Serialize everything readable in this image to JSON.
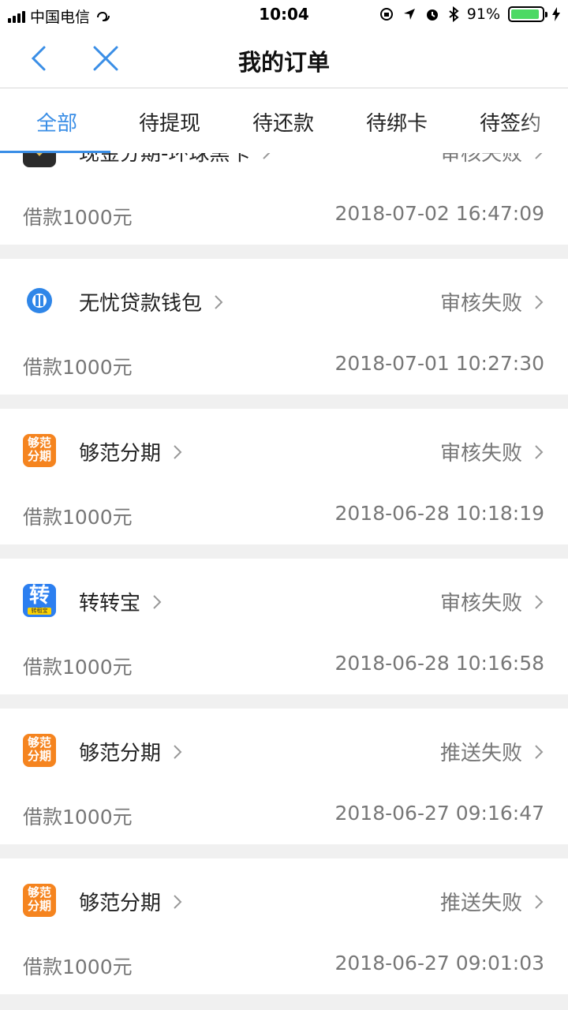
{
  "status_bar": {
    "carrier": "中国电信",
    "time": "10:04",
    "battery": "91%",
    "battery_level": 0.91
  },
  "nav": {
    "title": "我的订单"
  },
  "tabs": [
    {
      "label": "全部",
      "active": true
    },
    {
      "label": "待提现",
      "active": false
    },
    {
      "label": "待还款",
      "active": false
    },
    {
      "label": "待绑卡",
      "active": false
    },
    {
      "label": "待签约",
      "active": false
    }
  ],
  "orders": [
    {
      "name": "现金分期-环球黑卡",
      "status": "审核失败",
      "amount": "借款1000元",
      "time": "2018-07-02 16:47:09",
      "logo": "black-card-logo"
    },
    {
      "name": "无忧贷款钱包",
      "status": "审核失败",
      "amount": "借款1000元",
      "time": "2018-07-01 10:27:30",
      "logo": "wuyou-logo"
    },
    {
      "name": "够范分期",
      "status": "审核失败",
      "amount": "借款1000元",
      "time": "2018-06-28 10:18:19",
      "logo": "goufan-logo",
      "logo_text": [
        "够范",
        "分期"
      ]
    },
    {
      "name": "转转宝",
      "status": "审核失败",
      "amount": "借款1000元",
      "time": "2018-06-28 10:16:58",
      "logo": "zhuanzhuanbao-logo",
      "logo_text": [
        "转",
        "转租宝"
      ]
    },
    {
      "name": "够范分期",
      "status": "推送失败",
      "amount": "借款1000元",
      "time": "2018-06-27 09:16:47",
      "logo": "goufan-logo",
      "logo_text": [
        "够范",
        "分期"
      ]
    },
    {
      "name": "够范分期",
      "status": "推送失败",
      "amount": "借款1000元",
      "time": "2018-06-27 09:01:03",
      "logo": "goufan-logo",
      "logo_text": [
        "够范",
        "分期"
      ]
    }
  ],
  "colors": {
    "accent": "#3a8ee6",
    "goufan": "#f5841f",
    "zhuanzhuan": "#2c7ff0",
    "wuyou": "#2f86e8"
  }
}
